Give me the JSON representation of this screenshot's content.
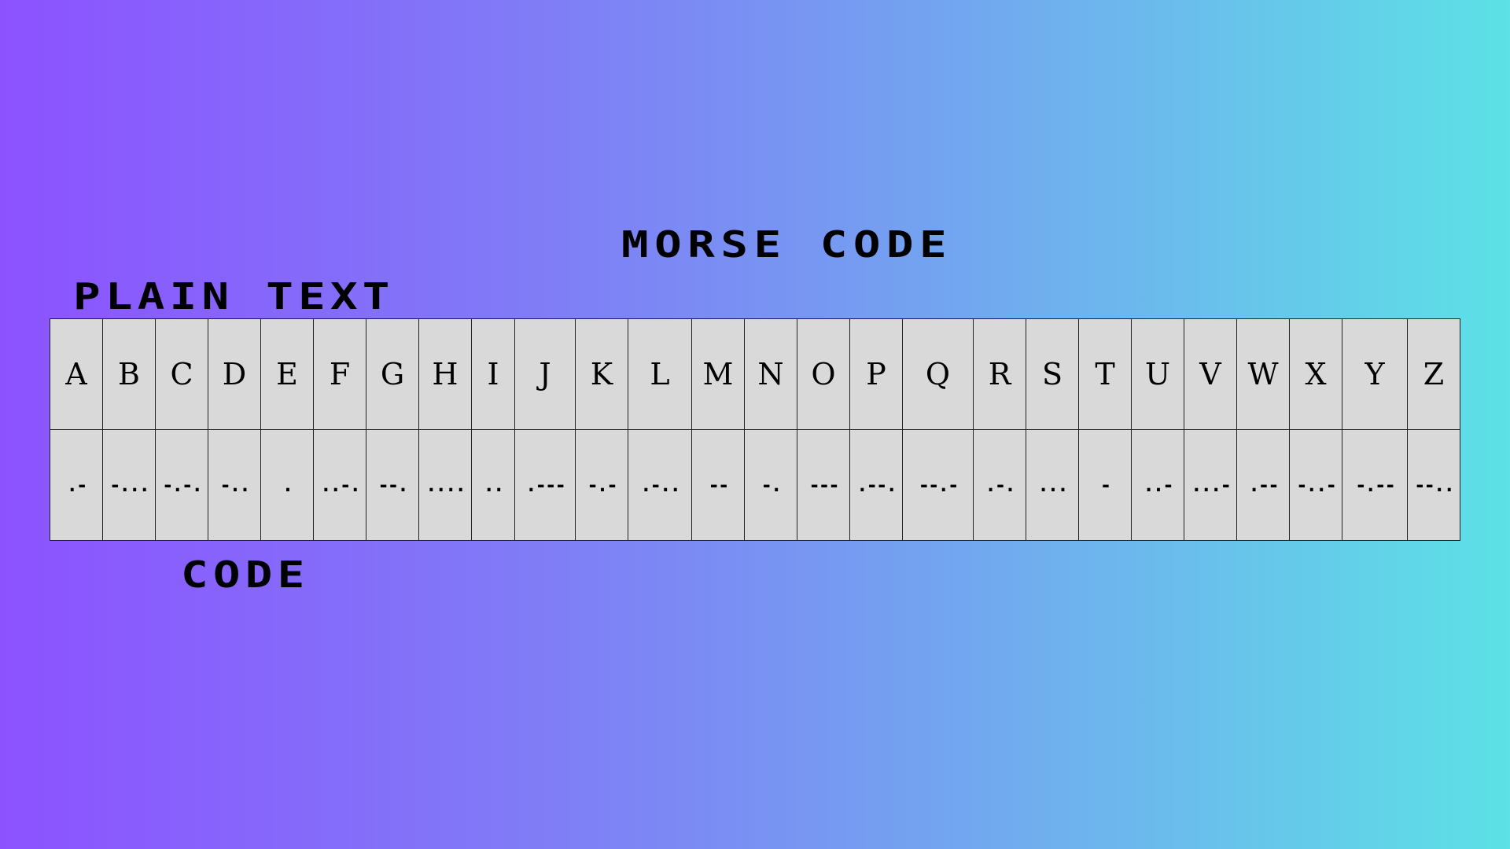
{
  "titles": {
    "morse_code": "MORSE CODE",
    "plain_text": "PLAIN TEXT",
    "code": "CODE"
  },
  "table": {
    "rows": [
      {
        "label": "plain-text",
        "cells": [
          "A",
          "B",
          "C",
          "D",
          "E",
          "F",
          "G",
          "H",
          "I",
          "J",
          "K",
          "L",
          "M",
          "N",
          "O",
          "P",
          "Q",
          "R",
          "S",
          "T",
          "U",
          "V",
          "W",
          "X",
          "Y",
          "Z"
        ]
      },
      {
        "label": "code",
        "cells": [
          ".-",
          "-...",
          "-.-.",
          "-..",
          ".",
          "..-.",
          "--.",
          "....",
          "..",
          ".---",
          "-.-",
          ".-..",
          "--",
          "-.",
          "---",
          ".--.",
          "--.-",
          ".-.",
          "...",
          "-",
          "..-",
          "...-",
          ".--",
          "-..-",
          "-.--",
          "--.."
        ]
      }
    ]
  },
  "colors": {
    "gradient_start": "#8c52ff",
    "gradient_end": "#5ce1e6",
    "cell_background": "#d9d9d9",
    "text": "#000000"
  }
}
